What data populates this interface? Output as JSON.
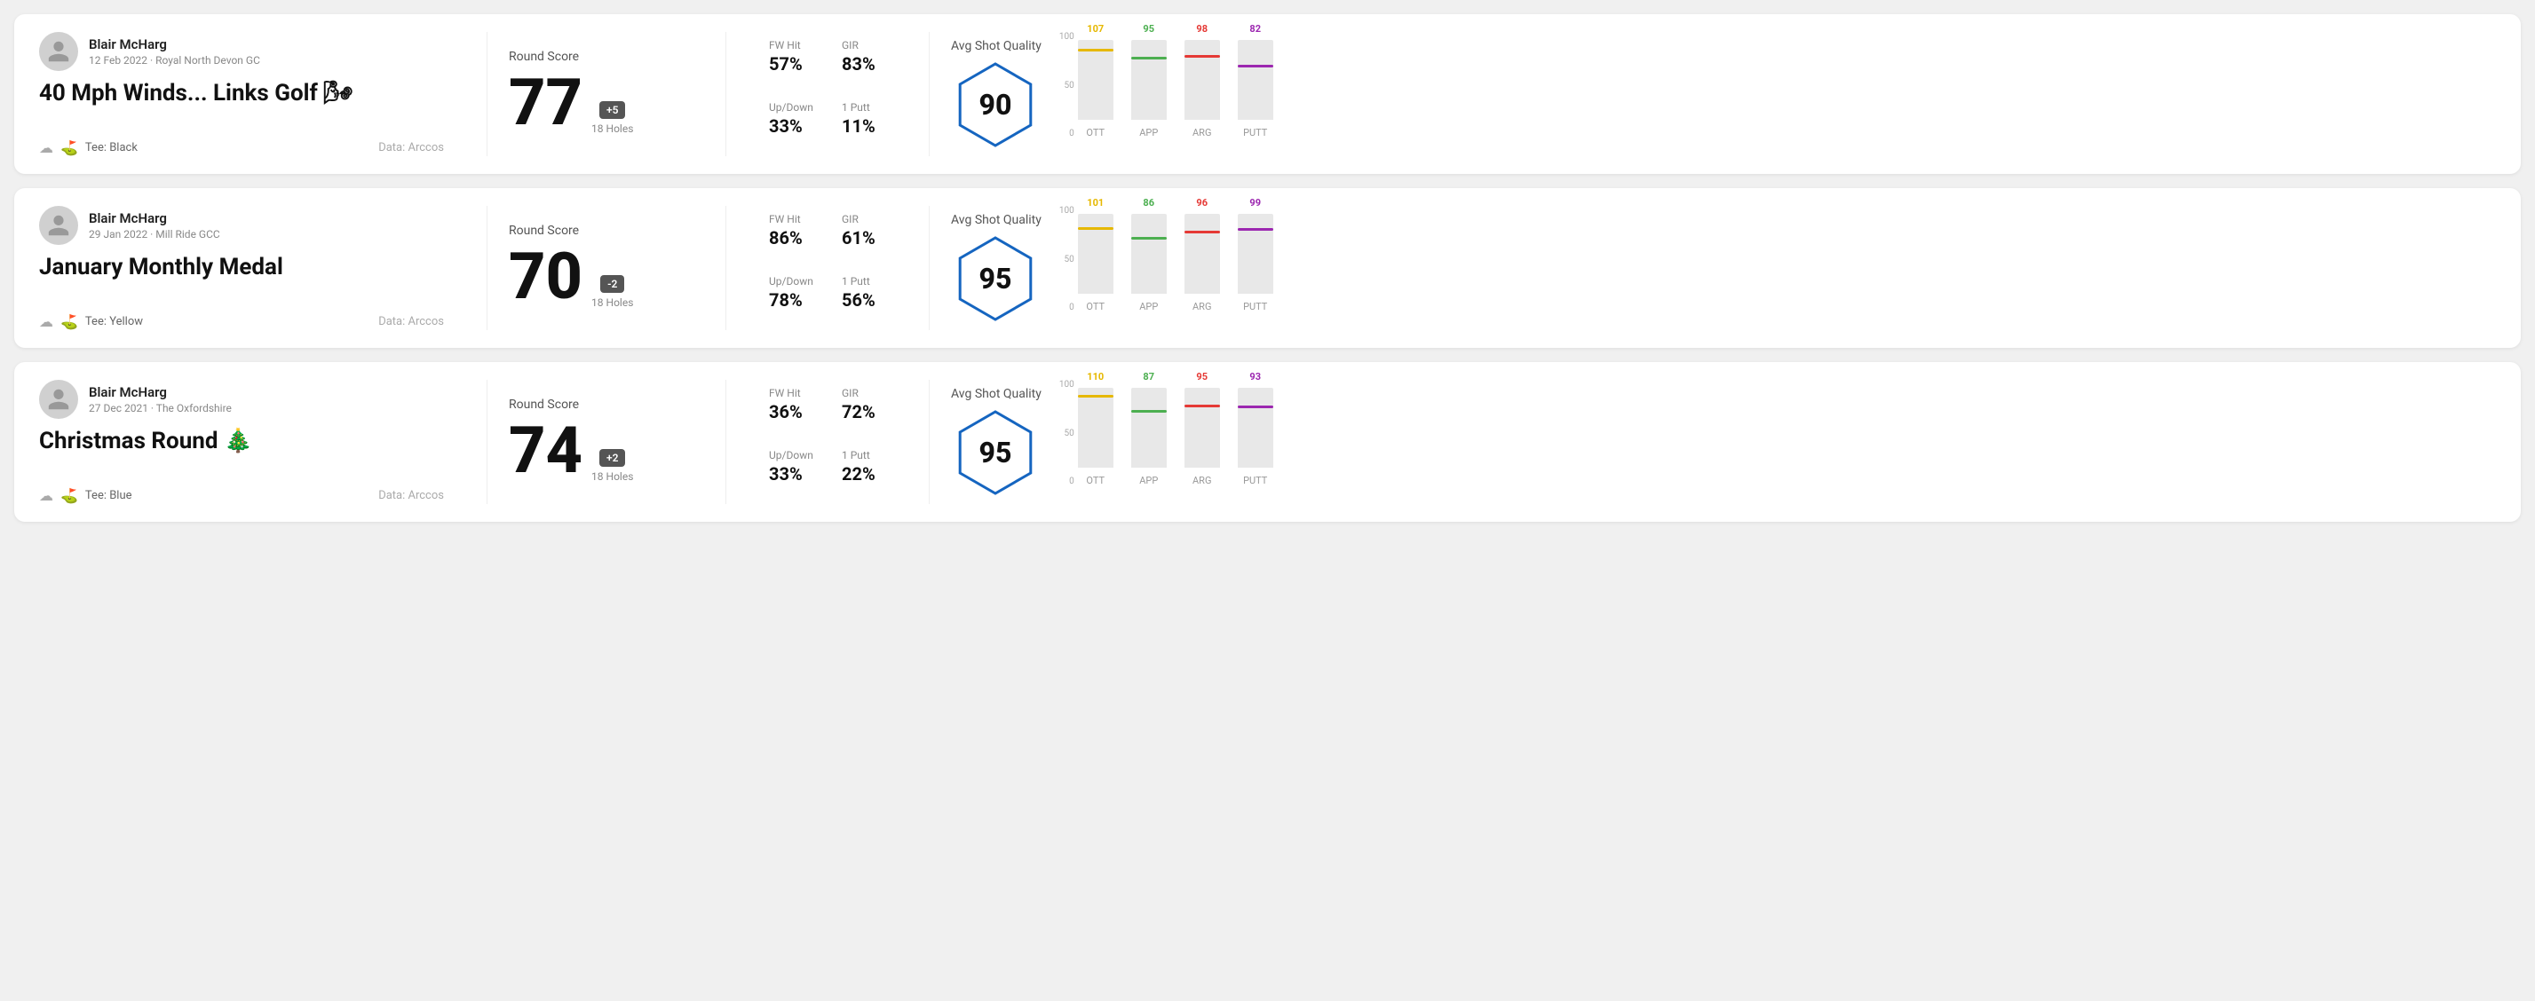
{
  "rounds": [
    {
      "id": "round-1",
      "user": {
        "name": "Blair McHarg",
        "date_course": "12 Feb 2022 · Royal North Devon GC"
      },
      "title": "40 Mph Winds... Links Golf 🌬",
      "tee": "Black",
      "data_source": "Data: Arccos",
      "score": "77",
      "score_diff": "+5",
      "score_diff_sign": "positive",
      "holes": "18 Holes",
      "fw_hit": "57%",
      "gir": "83%",
      "up_down": "33%",
      "one_putt": "11%",
      "avg_shot_quality": 90,
      "chart": {
        "bars": [
          {
            "label": "OTT",
            "value": 107,
            "color": "#e6b800",
            "fill_pct": 85
          },
          {
            "label": "APP",
            "value": 95,
            "color": "#4CAF50",
            "fill_pct": 75
          },
          {
            "label": "ARG",
            "value": 98,
            "color": "#e53935",
            "fill_pct": 78
          },
          {
            "label": "PUTT",
            "value": 82,
            "color": "#9c27b0",
            "fill_pct": 65
          }
        ]
      }
    },
    {
      "id": "round-2",
      "user": {
        "name": "Blair McHarg",
        "date_course": "29 Jan 2022 · Mill Ride GCC"
      },
      "title": "January Monthly Medal",
      "tee": "Yellow",
      "data_source": "Data: Arccos",
      "score": "70",
      "score_diff": "-2",
      "score_diff_sign": "negative",
      "holes": "18 Holes",
      "fw_hit": "86%",
      "gir": "61%",
      "up_down": "78%",
      "one_putt": "56%",
      "avg_shot_quality": 95,
      "chart": {
        "bars": [
          {
            "label": "OTT",
            "value": 101,
            "color": "#e6b800",
            "fill_pct": 80
          },
          {
            "label": "APP",
            "value": 86,
            "color": "#4CAF50",
            "fill_pct": 68
          },
          {
            "label": "ARG",
            "value": 96,
            "color": "#e53935",
            "fill_pct": 76
          },
          {
            "label": "PUTT",
            "value": 99,
            "color": "#9c27b0",
            "fill_pct": 79
          }
        ]
      }
    },
    {
      "id": "round-3",
      "user": {
        "name": "Blair McHarg",
        "date_course": "27 Dec 2021 · The Oxfordshire"
      },
      "title": "Christmas Round 🎄",
      "tee": "Blue",
      "data_source": "Data: Arccos",
      "score": "74",
      "score_diff": "+2",
      "score_diff_sign": "positive",
      "holes": "18 Holes",
      "fw_hit": "36%",
      "gir": "72%",
      "up_down": "33%",
      "one_putt": "22%",
      "avg_shot_quality": 95,
      "chart": {
        "bars": [
          {
            "label": "OTT",
            "value": 110,
            "color": "#e6b800",
            "fill_pct": 88
          },
          {
            "label": "APP",
            "value": 87,
            "color": "#4CAF50",
            "fill_pct": 69
          },
          {
            "label": "ARG",
            "value": 95,
            "color": "#e53935",
            "fill_pct": 75
          },
          {
            "label": "PUTT",
            "value": 93,
            "color": "#9c27b0",
            "fill_pct": 74
          }
        ]
      }
    }
  ],
  "labels": {
    "round_score": "Round Score",
    "fw_hit": "FW Hit",
    "gir": "GIR",
    "up_down": "Up/Down",
    "one_putt": "1 Putt",
    "avg_shot_quality": "Avg Shot Quality",
    "tee_prefix": "Tee:",
    "chart_y_100": "100",
    "chart_y_50": "50",
    "chart_y_0": "0"
  }
}
